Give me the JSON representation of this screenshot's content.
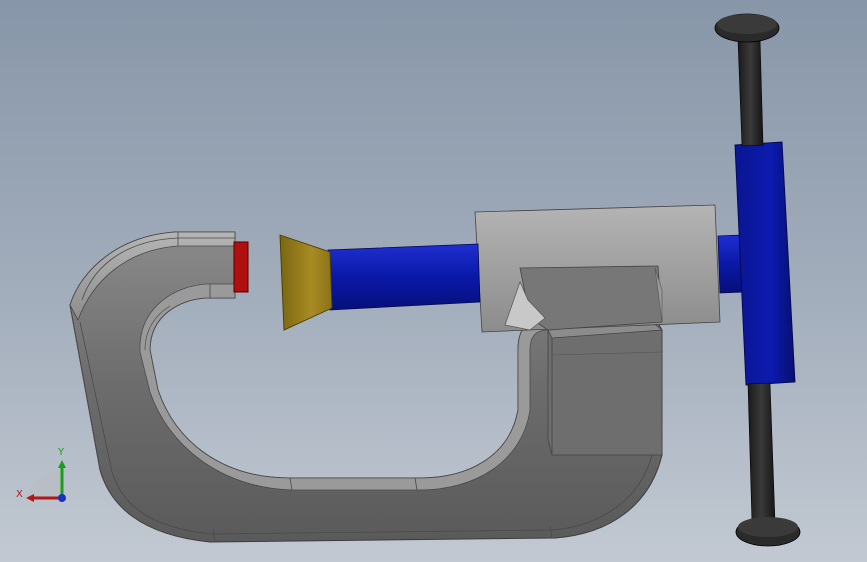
{
  "viewport": {
    "background_top": "#8796a8",
    "background_bottom": "#c2c9d2"
  },
  "model": {
    "frame_color": "#6a6a6a",
    "frame_highlight": "#a9a9a9",
    "screw_color": "#0a14a0",
    "tip_color": "#9a8020",
    "pad_color": "#b01010",
    "handle_color": "#2a2a2a"
  },
  "triad": {
    "x_label": "X",
    "y_label": "Y",
    "x_color": "#b01818",
    "y_color": "#18a018",
    "z_color": "#1830c0"
  }
}
